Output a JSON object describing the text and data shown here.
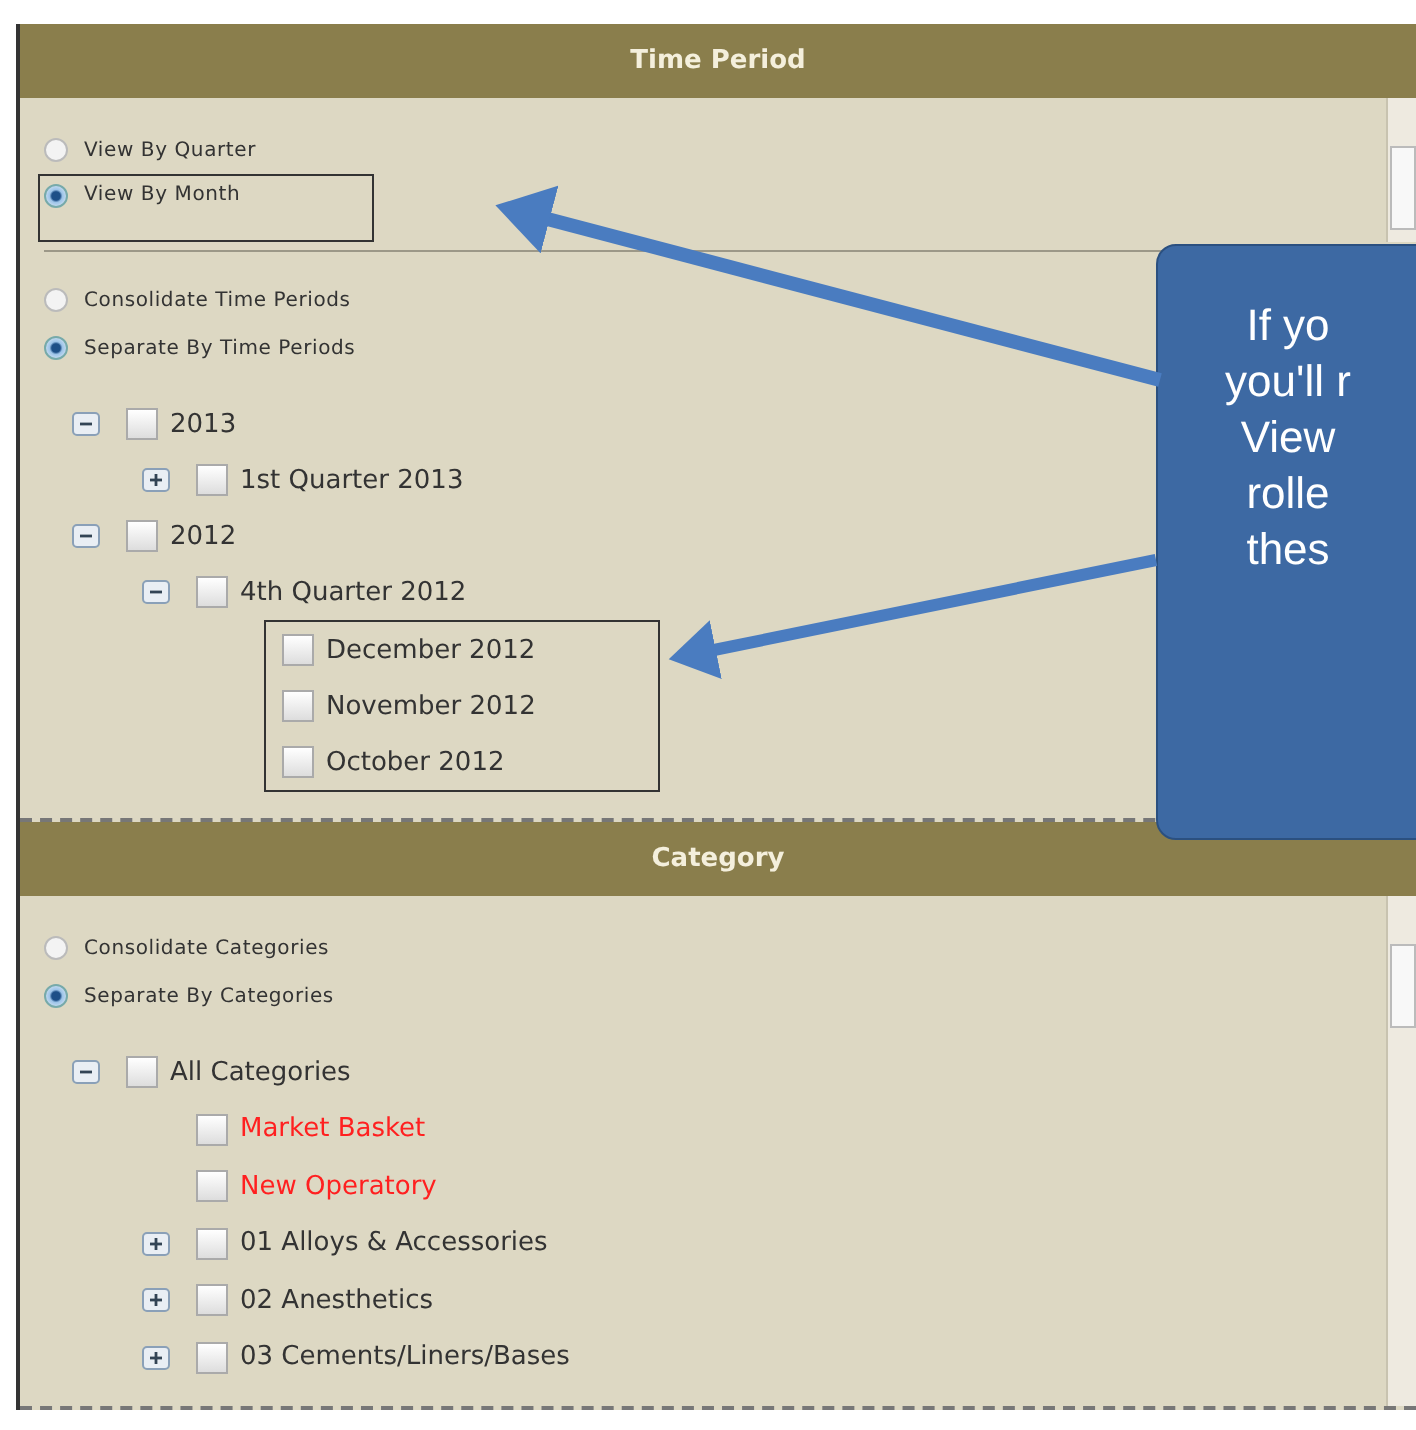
{
  "sections": [
    {
      "title": "Time Period",
      "radio_groups": [
        [
          {
            "label": "View By Quarter",
            "selected": false,
            "highlighted": false
          },
          {
            "label": "View By Month",
            "selected": true,
            "highlighted": true
          }
        ],
        [
          {
            "label": "Consolidate Time Periods",
            "selected": false,
            "highlighted": false
          },
          {
            "label": "Separate By Time Periods",
            "selected": true,
            "highlighted": false
          }
        ]
      ],
      "tree": [
        {
          "label": "2013",
          "expanded": true,
          "checked": false,
          "children": [
            {
              "label": "1st Quarter 2013",
              "expanded": false,
              "checked": false
            }
          ]
        },
        {
          "label": "2012",
          "expanded": true,
          "checked": false,
          "children": [
            {
              "label": "4th Quarter 2012",
              "expanded": true,
              "checked": false,
              "framed": true,
              "children": [
                {
                  "label": "December 2012",
                  "checked": false
                },
                {
                  "label": "November 2012",
                  "checked": false
                },
                {
                  "label": "October 2012",
                  "checked": false
                }
              ]
            }
          ]
        }
      ]
    },
    {
      "title": "Category",
      "radio_groups": [
        [
          {
            "label": "Consolidate Categories",
            "selected": false,
            "highlighted": false
          },
          {
            "label": "Separate By Categories",
            "selected": true,
            "highlighted": false
          }
        ]
      ],
      "tree": [
        {
          "label": "All Categories",
          "expanded": true,
          "checked": false,
          "children": [
            {
              "label": "Market Basket",
              "checked": false,
              "color": "#ff2020"
            },
            {
              "label": "New Operatory",
              "checked": false,
              "color": "#ff2020"
            },
            {
              "label": "01 Alloys & Accessories",
              "expanded": false,
              "checked": false
            },
            {
              "label": "02 Anesthetics",
              "expanded": false,
              "checked": false
            },
            {
              "label": "03 Cements/Liners/Bases",
              "expanded": false,
              "checked": false
            }
          ]
        }
      ]
    }
  ],
  "callout": {
    "lines": [
      "If yo",
      "you'll r",
      "View",
      "rolle",
      "thes"
    ]
  }
}
